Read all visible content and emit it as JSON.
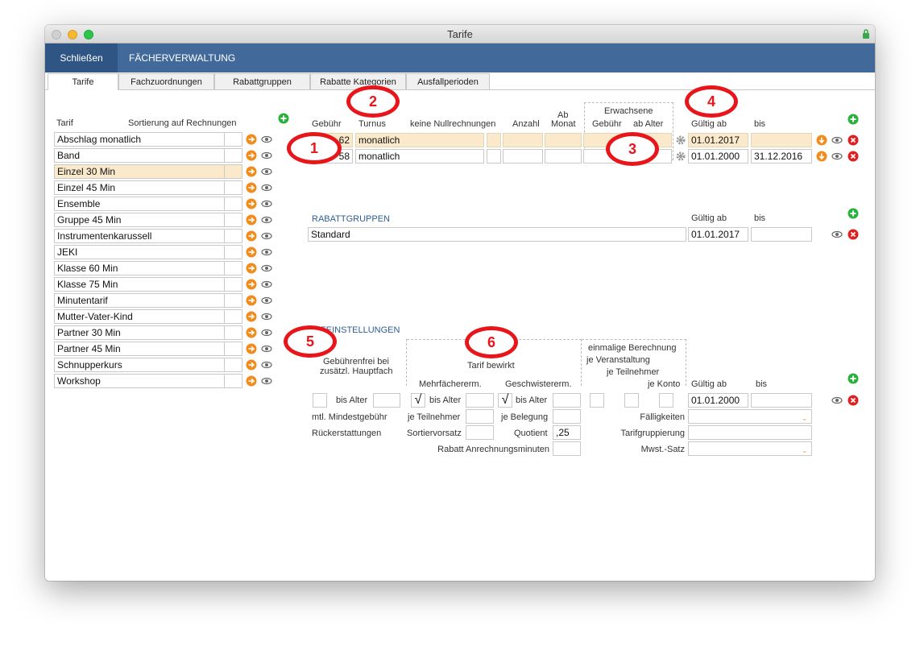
{
  "window": {
    "title": "Tarife"
  },
  "topbar": {
    "close_label": "Schließen",
    "faecher_label": "FÄCHERVERWALTUNG"
  },
  "tabs": [
    "Tarife",
    "Fachzuordnungen",
    "Rabattgruppen",
    "Rabatte Kategorien",
    "Ausfallperioden"
  ],
  "tarif_list": {
    "header_tarif": "Tarif",
    "header_sort": "Sortierung auf Rechnungen",
    "items": [
      "Abschlag monatlich",
      "Band",
      "Einzel 30 Min",
      "Einzel 45 Min",
      "Ensemble",
      "Gruppe 45 Min",
      "Instrumentenkarussell",
      "JEKI",
      "Klasse 60 Min",
      "Klasse 75 Min",
      "Minutentarif",
      "Mutter-Vater-Kind",
      "Partner 30 Min",
      "Partner 45 Min",
      "Schnupperkurs",
      "Workshop"
    ],
    "selected": "Einzel 30 Min"
  },
  "fees": {
    "headers": {
      "gebuehr": "Gebühr",
      "turnus": "Turnus",
      "keine_null": "keine Nullrechnungen",
      "anzahl": "Anzahl",
      "ab": "Ab",
      "monat": "Monat",
      "erwachsene": "Erwachsene",
      "erw_gebuehr": "Gebühr",
      "ab_alter": "ab Alter",
      "gueltig_ab": "Gültig ab",
      "bis": "bis"
    },
    "rows": [
      {
        "gebuehr": "62",
        "turnus": "monatlich",
        "gueltig_ab": "01.01.2017",
        "bis": ""
      },
      {
        "gebuehr": "58",
        "turnus": "monatlich",
        "gueltig_ab": "01.01.2000",
        "bis": "31.12.2016"
      }
    ]
  },
  "rabattgruppen": {
    "title": "RABATTGRUPPEN",
    "gueltig_ab": "Gültig ab",
    "bis": "bis",
    "row": {
      "name": "Standard",
      "gueltig_ab": "01.01.2017",
      "bis": ""
    }
  },
  "tarifeinstellungen": {
    "title": "IFEINSTELLUNGEN",
    "gebuehrenfrei": "Gebührenfrei bei",
    "zusaetzl": "zusätzl. Hauptfach",
    "tarif_bewirkt": "Tarif bewirkt",
    "mehrfach": "Mehrfächererm.",
    "geschwister": "Geschwistererm.",
    "einmalig": "einmalige Berechnung",
    "je_veranstaltung": "je Veranstaltung",
    "je_teilnehmer_top": "je Teilnehmer",
    "je_konto": "je Konto",
    "gueltig_ab": "Gültig ab",
    "bis": "bis",
    "bis_alter": "bis Alter",
    "gueltig_ab_value": "01.01.2000",
    "mtl_mindest": "mtl. Mindestgebühr",
    "je_teilnehmer": "je Teilnehmer",
    "je_belegung": "je Belegung",
    "faelligkeiten": "Fälligkeiten",
    "rueckerstattungen": "Rückerstattungen",
    "sortiervorsatz": "Sortiervorsatz",
    "quotient": "Quotient",
    "quotient_value": ",25",
    "tarifgruppierung": "Tarifgruppierung",
    "rabatt_anrechnung": "Rabatt Anrechnungsminuten",
    "mwst": "Mwst.-Satz",
    "check_mark": "√"
  },
  "annotations": [
    "1",
    "2",
    "3",
    "4",
    "5",
    "6"
  ],
  "colors": {
    "topbar": "#416a9b",
    "highlight": "#fbe9cc",
    "accent_orange": "#f08c1e",
    "add_green": "#27b23a",
    "delete_red": "#e02020",
    "annotation_red": "#e8161b"
  }
}
